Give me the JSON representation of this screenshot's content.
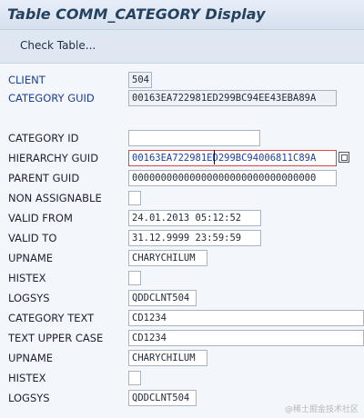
{
  "window": {
    "title": "Table COMM_CATEGORY Display"
  },
  "toolbar": {
    "check_table": "Check Table..."
  },
  "fields": [
    {
      "label": "CLIENT",
      "value": "504"
    },
    {
      "label": "CATEGORY GUID",
      "value": "00163EA722981ED299BC94EE43EBA89A"
    },
    {
      "label": "CATEGORY ID",
      "value": ""
    },
    {
      "label": "HIERARCHY GUID",
      "value": "00163EA722981ED299BC94006811C89A"
    },
    {
      "label": "PARENT GUID",
      "value": "00000000000000000000000000000000"
    },
    {
      "label": "NON ASSIGNABLE",
      "value": ""
    },
    {
      "label": "VALID FROM",
      "value": "24.01.2013 05:12:52"
    },
    {
      "label": "VALID TO",
      "value": "31.12.9999 23:59:59"
    },
    {
      "label": "UPNAME",
      "value": "CHARYCHILUM"
    },
    {
      "label": "HISTEX",
      "value": ""
    },
    {
      "label": "LOGSYS",
      "value": "QDDCLNT504"
    },
    {
      "label": "CATEGORY TEXT",
      "value": "CD1234"
    },
    {
      "label": "TEXT UPPER CASE",
      "value": "CD1234"
    },
    {
      "label": "UPNAME",
      "value": "CHARYCHILUM"
    },
    {
      "label": "HISTEX",
      "value": ""
    },
    {
      "label": "LOGSYS",
      "value": "QDDCLNT504"
    }
  ],
  "watermark": "@稀土掘金技术社区"
}
